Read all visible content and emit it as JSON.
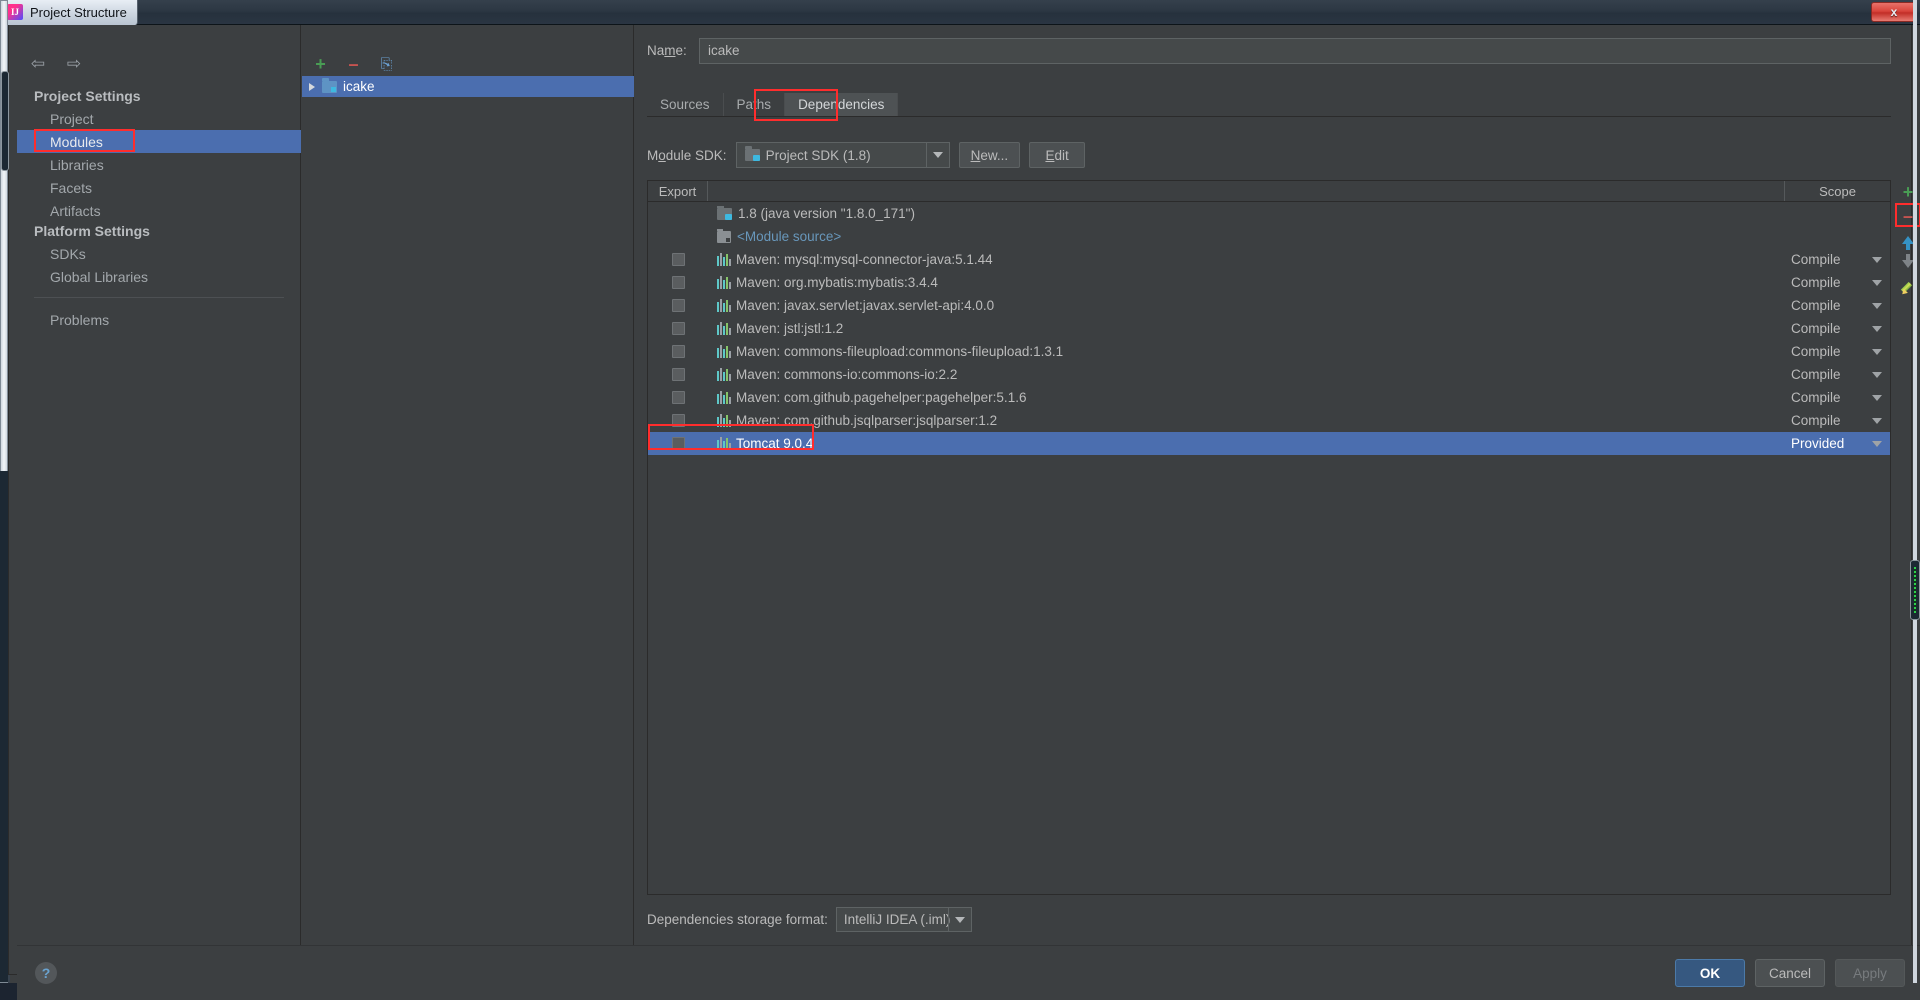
{
  "window": {
    "title": "Project Structure",
    "close_label": "x",
    "app_icon": "intellij-idea-icon"
  },
  "sidebar": {
    "back_icon": "arrow-left-icon",
    "forward_icon": "arrow-right-icon",
    "groups": [
      {
        "label": "Project Settings"
      },
      {
        "label": "Platform Settings"
      }
    ],
    "items": [
      {
        "label": "Project",
        "selected": false
      },
      {
        "label": "Modules",
        "selected": true
      },
      {
        "label": "Libraries",
        "selected": false
      },
      {
        "label": "Facets",
        "selected": false
      },
      {
        "label": "Artifacts",
        "selected": false
      },
      {
        "label": "SDKs",
        "selected": false
      },
      {
        "label": "Global Libraries",
        "selected": false
      },
      {
        "label": "Problems",
        "selected": false
      }
    ],
    "highlight_color": "#ff2d2d"
  },
  "tree_panel": {
    "toolbar": {
      "add_label": "+",
      "remove_label": "–",
      "copy_label": "⎘"
    },
    "nodes": [
      {
        "label": "icake",
        "selected": true,
        "expander": "collapsed-triangle"
      }
    ]
  },
  "main": {
    "name": {
      "label_pre": "Na",
      "label_mnemonic": "m",
      "label_post": "e:",
      "value": "icake"
    },
    "tabs": [
      {
        "label": "Sources",
        "active": false
      },
      {
        "label": "Paths",
        "active": false
      },
      {
        "label": "Dependencies",
        "active": true
      }
    ],
    "sdk": {
      "label_pre": "M",
      "label_mnemonic": "o",
      "label_post": "dule SDK:",
      "value": "Project SDK (1.8)",
      "new_button": {
        "pre": "",
        "mnemonic": "N",
        "post": "ew..."
      },
      "edit_button": {
        "pre": "",
        "mnemonic": "E",
        "post": "dit"
      }
    },
    "table": {
      "headers": {
        "export": "Export",
        "scope": "Scope"
      },
      "rows": [
        {
          "name": "1.8 (java version \"1.8.0_171\")",
          "icon": "sdk-folder-icon",
          "checkbox": false,
          "scope": "",
          "selected": false,
          "style": "sdk"
        },
        {
          "name": "<Module source>",
          "icon": "module-source-icon",
          "checkbox": false,
          "scope": "",
          "selected": false,
          "style": "link"
        },
        {
          "name": "Maven: mysql:mysql-connector-java:5.1.44",
          "icon": "jar-icon",
          "checkbox": true,
          "scope": "Compile",
          "selected": false,
          "style": "normal"
        },
        {
          "name": "Maven: org.mybatis:mybatis:3.4.4",
          "icon": "jar-icon",
          "checkbox": true,
          "scope": "Compile",
          "selected": false,
          "style": "normal"
        },
        {
          "name": "Maven: javax.servlet:javax.servlet-api:4.0.0",
          "icon": "jar-icon",
          "checkbox": true,
          "scope": "Compile",
          "selected": false,
          "style": "normal"
        },
        {
          "name": "Maven: jstl:jstl:1.2",
          "icon": "jar-icon",
          "checkbox": true,
          "scope": "Compile",
          "selected": false,
          "style": "normal"
        },
        {
          "name": "Maven: commons-fileupload:commons-fileupload:1.3.1",
          "icon": "jar-icon",
          "checkbox": true,
          "scope": "Compile",
          "selected": false,
          "style": "normal"
        },
        {
          "name": "Maven: commons-io:commons-io:2.2",
          "icon": "jar-icon",
          "checkbox": true,
          "scope": "Compile",
          "selected": false,
          "style": "normal"
        },
        {
          "name": "Maven: com.github.pagehelper:pagehelper:5.1.6",
          "icon": "jar-icon",
          "checkbox": true,
          "scope": "Compile",
          "selected": false,
          "style": "normal"
        },
        {
          "name": "Maven: com.github.jsqlparser:jsqlparser:1.2",
          "icon": "jar-icon",
          "checkbox": true,
          "scope": "Compile",
          "selected": false,
          "style": "normal"
        },
        {
          "name": "Tomcat 9.0.4",
          "icon": "jar-icon",
          "checkbox": true,
          "scope": "Provided",
          "selected": true,
          "style": "normal"
        }
      ]
    },
    "side_toolbar": [
      {
        "icon": "plus-icon",
        "label": "+",
        "highlighted": false
      },
      {
        "icon": "minus-icon",
        "label": "–",
        "highlighted": true
      },
      {
        "icon": "arrow-up-icon",
        "label": "",
        "highlighted": false
      },
      {
        "icon": "arrow-down-icon",
        "label": "",
        "highlighted": false
      },
      {
        "icon": "edit-pencil-icon",
        "label": "",
        "highlighted": false
      }
    ],
    "storage": {
      "label": "Dependencies storage format:",
      "value": "IntelliJ IDEA (.iml)"
    }
  },
  "bottom": {
    "help_label": "?",
    "buttons": [
      {
        "label": "OK",
        "kind": "primary"
      },
      {
        "label": "Cancel",
        "kind": "normal"
      },
      {
        "label": "Apply",
        "kind": "disabled"
      }
    ]
  }
}
